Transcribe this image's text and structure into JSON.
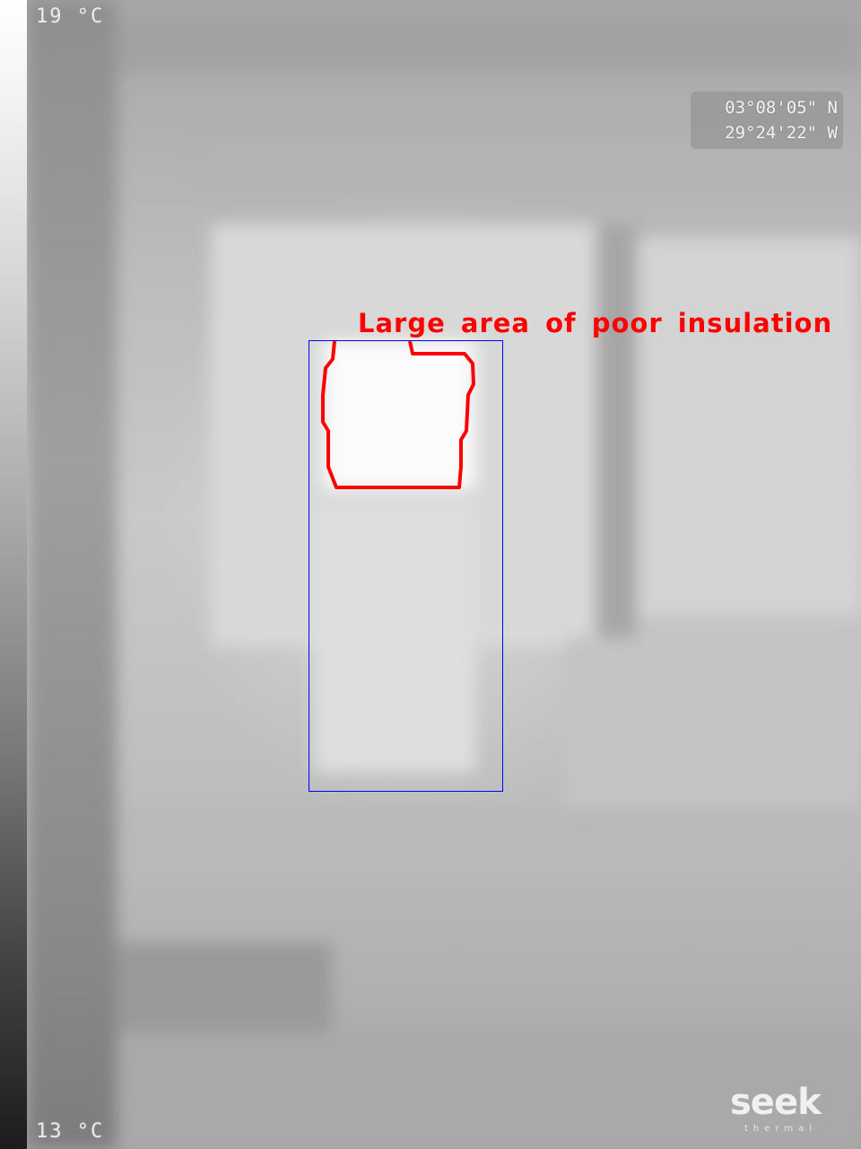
{
  "thermal_image": {
    "scale_max_label": "19 °C",
    "scale_min_label": "13 °C",
    "readout_line1": "03°08'05\" N",
    "readout_line2": "29°24'22\" W",
    "brand_name": "seek",
    "brand_subtitle": "thermal"
  },
  "annotation": {
    "label": "Large area of poor insulation",
    "outline_color": "#ff0000",
    "box_color": "#0000ff"
  }
}
